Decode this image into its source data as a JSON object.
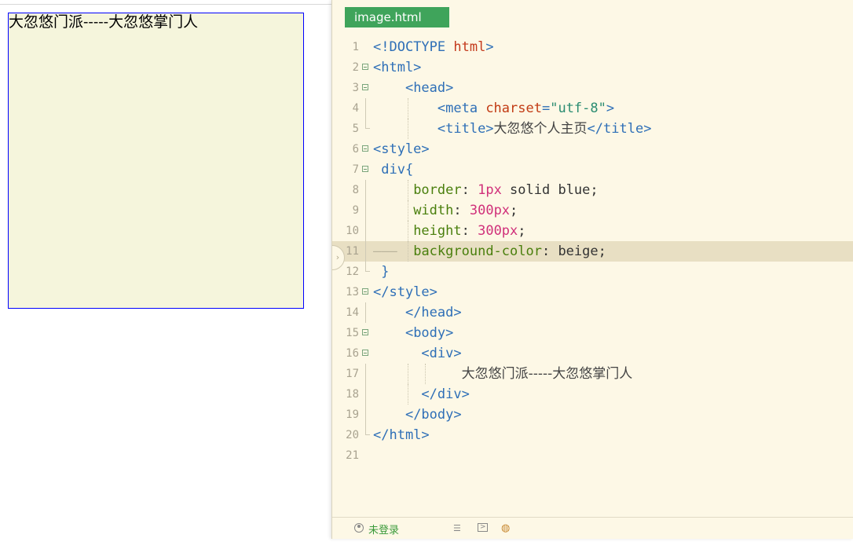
{
  "preview": {
    "div_text": "大忽悠门派-----大忽悠掌门人"
  },
  "editor": {
    "tab_label": "image.html",
    "lines": [
      {
        "n": "1",
        "tokens": [
          [
            "tag",
            "<!DOCTYPE "
          ],
          [
            "kw",
            "html"
          ],
          [
            "tag",
            ">"
          ]
        ]
      },
      {
        "n": "2",
        "tokens": [
          [
            "tag",
            "<html>"
          ]
        ]
      },
      {
        "n": "3",
        "tokens": [
          [
            "plain",
            "    "
          ],
          [
            "tag",
            "<head>"
          ]
        ]
      },
      {
        "n": "4",
        "tokens": [
          [
            "plain",
            "        "
          ],
          [
            "tag",
            "<meta "
          ],
          [
            "attr",
            "charset"
          ],
          [
            "tag",
            "="
          ],
          [
            "str",
            "\"utf-8\""
          ],
          [
            "tag",
            ">"
          ]
        ]
      },
      {
        "n": "5",
        "tokens": [
          [
            "plain",
            "        "
          ],
          [
            "tag",
            "<title>"
          ],
          [
            "cjk",
            "大忽悠个人主页"
          ],
          [
            "tag",
            "</title>"
          ]
        ]
      },
      {
        "n": "6",
        "tokens": [
          [
            "tag",
            "<style>"
          ]
        ]
      },
      {
        "n": "7",
        "tokens": [
          [
            "plain",
            " "
          ],
          [
            "tag",
            "div{"
          ]
        ]
      },
      {
        "n": "8",
        "tokens": [
          [
            "plain",
            "     "
          ],
          [
            "prop",
            "border"
          ],
          [
            "plain",
            ": "
          ],
          [
            "num",
            "1px"
          ],
          [
            "plain",
            " solid blue;"
          ]
        ]
      },
      {
        "n": "9",
        "tokens": [
          [
            "plain",
            "     "
          ],
          [
            "prop",
            "width"
          ],
          [
            "plain",
            ": "
          ],
          [
            "num",
            "300px"
          ],
          [
            "plain",
            ";"
          ]
        ]
      },
      {
        "n": "10",
        "tokens": [
          [
            "plain",
            "     "
          ],
          [
            "prop",
            "height"
          ],
          [
            "plain",
            ": "
          ],
          [
            "num",
            "300px"
          ],
          [
            "plain",
            ";"
          ]
        ]
      },
      {
        "n": "11",
        "tokens": [
          [
            "dash",
            "——— "
          ],
          [
            "plain",
            " "
          ],
          [
            "prop",
            "background-color"
          ],
          [
            "plain",
            ": beige;"
          ]
        ]
      },
      {
        "n": "12",
        "tokens": [
          [
            "plain",
            " "
          ],
          [
            "tag",
            "}"
          ]
        ]
      },
      {
        "n": "13",
        "tokens": [
          [
            "tag",
            "</style>"
          ]
        ]
      },
      {
        "n": "14",
        "tokens": [
          [
            "plain",
            "    "
          ],
          [
            "tag",
            "</head>"
          ]
        ]
      },
      {
        "n": "15",
        "tokens": [
          [
            "plain",
            "    "
          ],
          [
            "tag",
            "<body>"
          ]
        ]
      },
      {
        "n": "16",
        "tokens": [
          [
            "plain",
            "      "
          ],
          [
            "tag",
            "<div>"
          ]
        ]
      },
      {
        "n": "17",
        "tokens": [
          [
            "plain",
            "           "
          ],
          [
            "cjk",
            "大忽悠门派-----大忽悠掌门人"
          ]
        ]
      },
      {
        "n": "18",
        "tokens": [
          [
            "plain",
            "      "
          ],
          [
            "tag",
            "</div>"
          ]
        ]
      },
      {
        "n": "19",
        "tokens": [
          [
            "plain",
            "    "
          ],
          [
            "tag",
            "</body>"
          ]
        ]
      },
      {
        "n": "20",
        "tokens": [
          [
            "tag",
            "</html>"
          ]
        ]
      },
      {
        "n": "21",
        "tokens": []
      }
    ],
    "active_line": "11"
  },
  "statusbar": {
    "login_label": "未登录",
    "icons": [
      "list-icon",
      "terminal-icon",
      "browser-icon"
    ]
  },
  "colors": {
    "div_background": "#f5f5dc",
    "div_border": "#0000ff",
    "editor_background": "#fdf8e6",
    "tab_background": "#3fa45b"
  }
}
